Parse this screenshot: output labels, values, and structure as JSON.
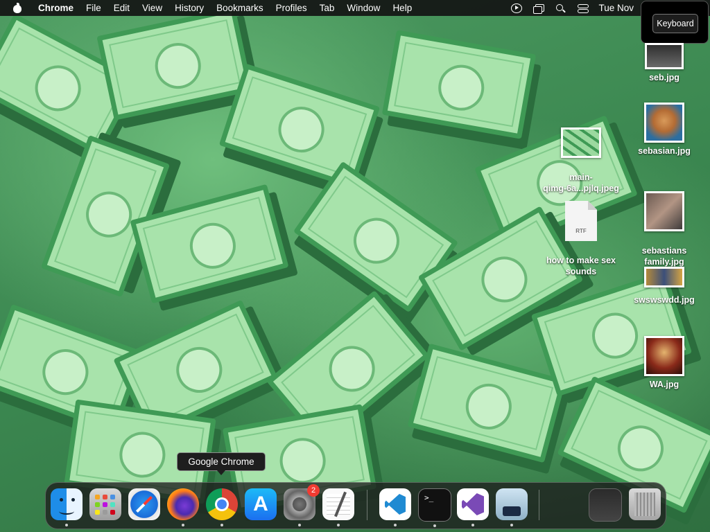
{
  "menubar": {
    "app_name": "Chrome",
    "items": [
      "File",
      "Edit",
      "View",
      "History",
      "Bookmarks",
      "Profiles",
      "Tab",
      "Window",
      "Help"
    ],
    "clock": "Tue Nov"
  },
  "keyboard_popup": {
    "label": "Keyboard"
  },
  "desktop": {
    "icons": [
      {
        "name": "seb.jpg"
      },
      {
        "name": "sebasian.jpg"
      },
      {
        "name": "main-\nqimg-6a...pjlq.jpeg"
      },
      {
        "name": "sebastians\nfamily.jpg"
      },
      {
        "name": "how to make sex\nsounds",
        "type_label": "RTF"
      },
      {
        "name": "swswswdd.jpg"
      },
      {
        "name": "WA.jpg"
      }
    ]
  },
  "tooltip": {
    "text": "Google Chrome"
  },
  "dock": {
    "apps": [
      {
        "icon": "finder-icon"
      },
      {
        "icon": "launchpad-icon"
      },
      {
        "icon": "safari-icon"
      },
      {
        "icon": "firefox-icon"
      },
      {
        "icon": "chrome-icon"
      },
      {
        "icon": "app-store-icon"
      },
      {
        "icon": "system-settings-icon",
        "badge": "2"
      },
      {
        "icon": "textedit-icon"
      },
      {
        "icon": "vscode-icon"
      },
      {
        "icon": "terminal-icon"
      },
      {
        "icon": "visual-studio-icon"
      },
      {
        "icon": "preview-icon"
      },
      {
        "icon": "recent-window-icon"
      },
      {
        "icon": "trash-icon"
      }
    ]
  }
}
